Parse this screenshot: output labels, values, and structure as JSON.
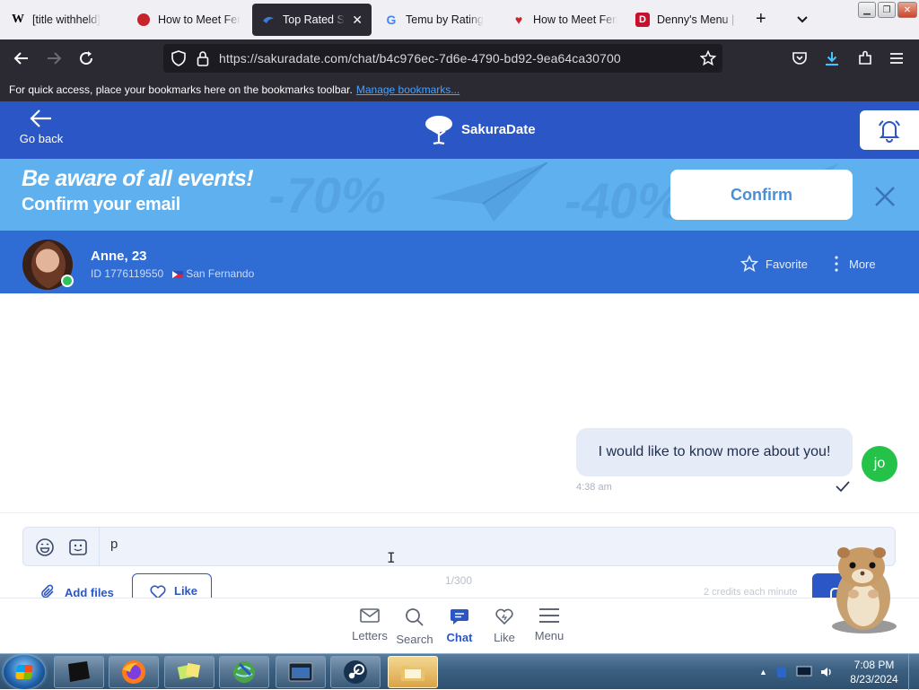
{
  "browser": {
    "tabs": [
      {
        "favicon": "W",
        "title": "[title withheld]",
        "active": false
      },
      {
        "favicon": "red-circle",
        "title": "How to Meet Fem",
        "active": false
      },
      {
        "favicon": "sakura-icon",
        "title": "Top Rated Sing",
        "active": true
      },
      {
        "favicon": "G",
        "title": "Temu by Rating",
        "active": false
      },
      {
        "favicon": "red-heart",
        "title": "How to Meet Fem",
        "active": false
      },
      {
        "favicon": "D",
        "title": "Denny's Menu | B",
        "active": false
      }
    ],
    "url_host": "https://sakuradate.com",
    "url_path": "/chat/b4c976ec-7d6e-4790-bd92-9ea64ca30700",
    "bookmarks_text": "For quick access, place your bookmarks here on the bookmarks toolbar.",
    "bookmarks_link": "Manage bookmarks..."
  },
  "site": {
    "go_back": "Go back",
    "brand": "SakuraDate"
  },
  "banner": {
    "headline": "Be aware of all events!",
    "subline": "Confirm your email",
    "confirm": "Confirm",
    "deco1": "-70%",
    "deco2": "-40%"
  },
  "profile": {
    "name": "Anne, 23",
    "id": "ID 1776119550",
    "location": "San Fernando",
    "favorite": "Favorite",
    "more": "More"
  },
  "chat": {
    "message": "I would like to know more about you!",
    "time": "4:38 am",
    "me_initials": "jo"
  },
  "composer": {
    "text": "p",
    "add_files": "Add files",
    "like": "Like",
    "counter": "1/300",
    "credits": "2 credits each minute"
  },
  "bottom_nav": [
    {
      "label": "Letters",
      "icon": "envelope-icon"
    },
    {
      "label": "Search",
      "icon": "search-icon"
    },
    {
      "label": "Chat",
      "icon": "chat-icon",
      "active": true
    },
    {
      "label": "Like",
      "icon": "heart-icon"
    },
    {
      "label": "Menu",
      "icon": "menu-icon"
    }
  ],
  "taskbar": {
    "time": "7:08 PM",
    "date": "8/23/2024"
  },
  "colors": {
    "brand_blue": "#2a56c6",
    "banner_blue": "#5fb0ef",
    "online_green": "#2fc25f"
  }
}
